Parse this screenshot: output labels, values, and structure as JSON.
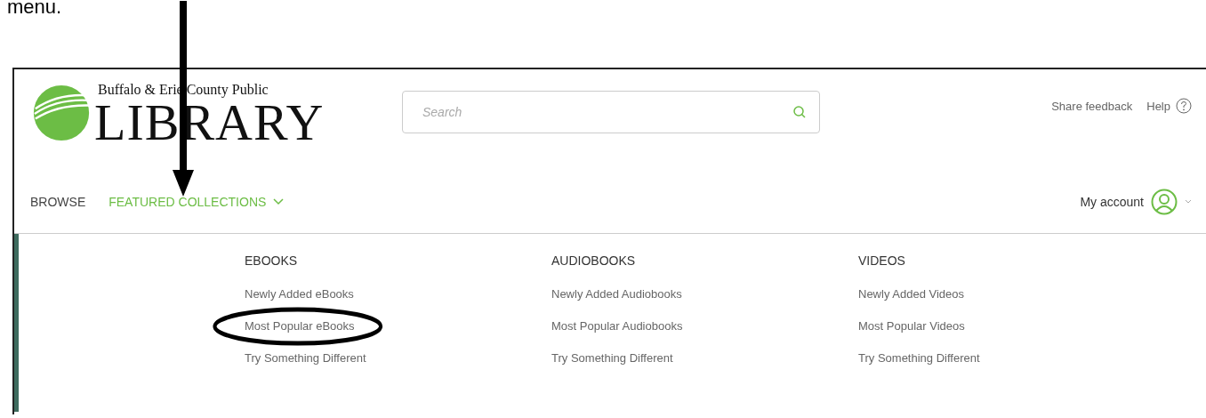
{
  "caption": "menu.",
  "logo": {
    "line_1": "Buffalo & Erie County Public",
    "line_2": "LIBRARY"
  },
  "search": {
    "placeholder": "Search"
  },
  "top_links": [
    {
      "label": "Share feedback",
      "kind": "text"
    },
    {
      "label": "Help",
      "kind": "help"
    }
  ],
  "nav": [
    {
      "label": "BROWSE",
      "selected": false,
      "dropdown": false,
      "pointed": false
    },
    {
      "label": "FEATURED COLLECTIONS",
      "selected": true,
      "dropdown": true,
      "pointed": true
    }
  ],
  "account": {
    "label": "My account"
  },
  "menu": [
    {
      "heading": "EBOOKS",
      "items": [
        {
          "label": "Newly Added eBooks",
          "circled": false
        },
        {
          "label": "Most Popular eBooks",
          "circled": true
        },
        {
          "label": "Try Something Different",
          "circled": false
        }
      ]
    },
    {
      "heading": "AUDIOBOOKS",
      "items": [
        {
          "label": "Newly Added Audiobooks",
          "circled": false
        },
        {
          "label": "Most Popular Audiobooks",
          "circled": false
        },
        {
          "label": "Try Something Different",
          "circled": false
        }
      ]
    },
    {
      "heading": "VIDEOS",
      "items": [
        {
          "label": "Newly Added Videos",
          "circled": false
        },
        {
          "label": "Most Popular Videos",
          "circled": false
        },
        {
          "label": "Try Something Different",
          "circled": false
        }
      ]
    }
  ]
}
